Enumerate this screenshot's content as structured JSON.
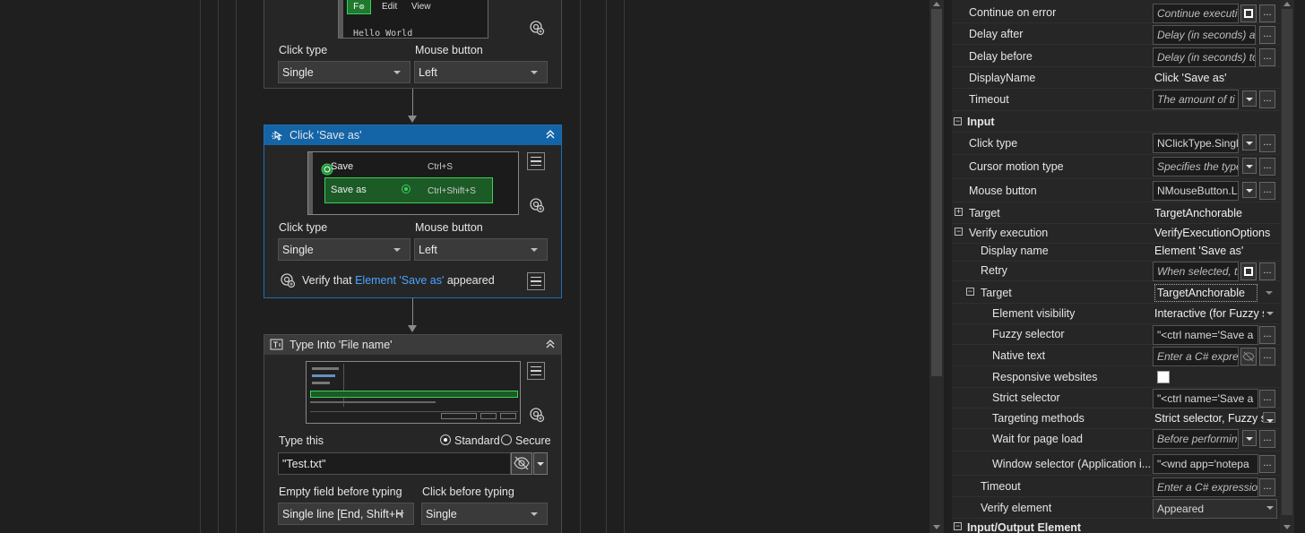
{
  "workflow": {
    "card1": {
      "preview": {
        "menu_edit": "Edit",
        "menu_view": "View",
        "text": "Hello World"
      },
      "click_type_label": "Click type",
      "mouse_button_label": "Mouse button",
      "click_type_value": "Single",
      "mouse_button_value": "Left"
    },
    "card2": {
      "title": "Click 'Save as'",
      "preview": {
        "item1": "Save",
        "item1_shortcut": "Ctrl+S",
        "item2": "Save as",
        "item2_shortcut": "Ctrl+Shift+S"
      },
      "click_type_label": "Click type",
      "mouse_button_label": "Mouse button",
      "click_type_value": "Single",
      "mouse_button_value": "Left",
      "verify_prefix": "Verify that",
      "verify_element": "Element 'Save as'",
      "verify_suffix": "appeared"
    },
    "card3": {
      "title": "Type Into 'File name'",
      "type_this_label": "Type this",
      "radio_standard": "Standard",
      "radio_secure": "Secure",
      "text_value": "\"Test.txt\"",
      "empty_field_label": "Empty field before typing",
      "click_before_label": "Click before typing",
      "empty_field_value": "Single line [End, Shift+H",
      "click_before_value": "Single"
    }
  },
  "properties": {
    "rows": [
      {
        "name": "Continue on error",
        "value": "Continue executi"
      },
      {
        "name": "Delay after",
        "value": "Delay (in seconds) af"
      },
      {
        "name": "Delay before",
        "value": "Delay (in seconds) to"
      },
      {
        "name": "DisplayName",
        "value": "Click 'Save as'"
      },
      {
        "name": "Timeout",
        "value": "The amount of ti"
      },
      {
        "name": "Input"
      },
      {
        "name": "Click type",
        "value": "NClickType.Singl"
      },
      {
        "name": "Cursor motion type",
        "value": "Specifies the type"
      },
      {
        "name": "Mouse button",
        "value": "NMouseButton.L"
      },
      {
        "name": "Target",
        "value": "TargetAnchorable"
      },
      {
        "name": "Verify execution",
        "value": "VerifyExecutionOptions"
      },
      {
        "name": "Display name",
        "value": "Element 'Save as'"
      },
      {
        "name": "Retry",
        "value": "When selected, tl"
      },
      {
        "name": "Target",
        "value": "TargetAnchorable"
      },
      {
        "name": "Element visibility",
        "value": "Interactive (for Fuzzy s"
      },
      {
        "name": "Fuzzy selector",
        "value": "\"<ctrl name='Save a"
      },
      {
        "name": "Native text",
        "value": "Enter a C# expres"
      },
      {
        "name": "Responsive websites"
      },
      {
        "name": "Strict selector",
        "value": "\"<ctrl name='Save a"
      },
      {
        "name": "Targeting methods",
        "value": "Strict selector, Fuzzy s"
      },
      {
        "name": "Wait for page load",
        "value": "Before performin"
      },
      {
        "name": "Window selector (Application i...",
        "value": "\"<wnd app='notepa"
      },
      {
        "name": "Timeout",
        "value": "Enter a C# expression"
      },
      {
        "name": "Verify element",
        "value": "Appeared"
      },
      {
        "name": "Input/Output Element"
      }
    ]
  }
}
